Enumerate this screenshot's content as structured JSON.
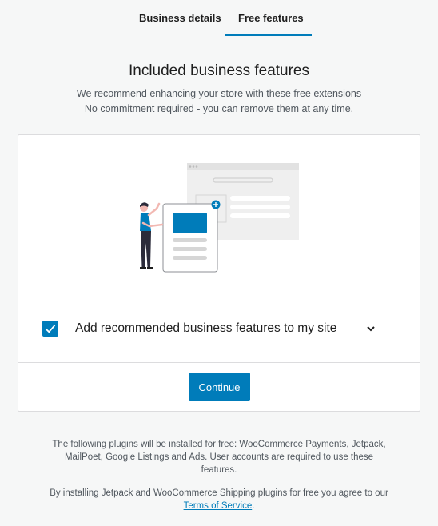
{
  "tabs": [
    {
      "label": "Business details",
      "active": false
    },
    {
      "label": "Free features",
      "active": true
    }
  ],
  "accent_color": "#007cba",
  "heading": "Included business features",
  "subtext_line1": "We recommend enhancing your store with these free extensions",
  "subtext_line2": "No commitment required - you can remove them at any time.",
  "feature": {
    "checked": true,
    "label": "Add recommended business features to my site",
    "expand_icon": "chevron-down-icon"
  },
  "continue_label": "Continue",
  "footer": {
    "plugins_text": "The following plugins will be installed for free: WooCommerce Payments, Jetpack, MailPoet, Google Listings and Ads. User accounts are required to use these features.",
    "terms_prefix": "By installing Jetpack and WooCommerce Shipping plugins for free you agree to our ",
    "terms_link": "Terms of Service",
    "terms_suffix": "."
  }
}
